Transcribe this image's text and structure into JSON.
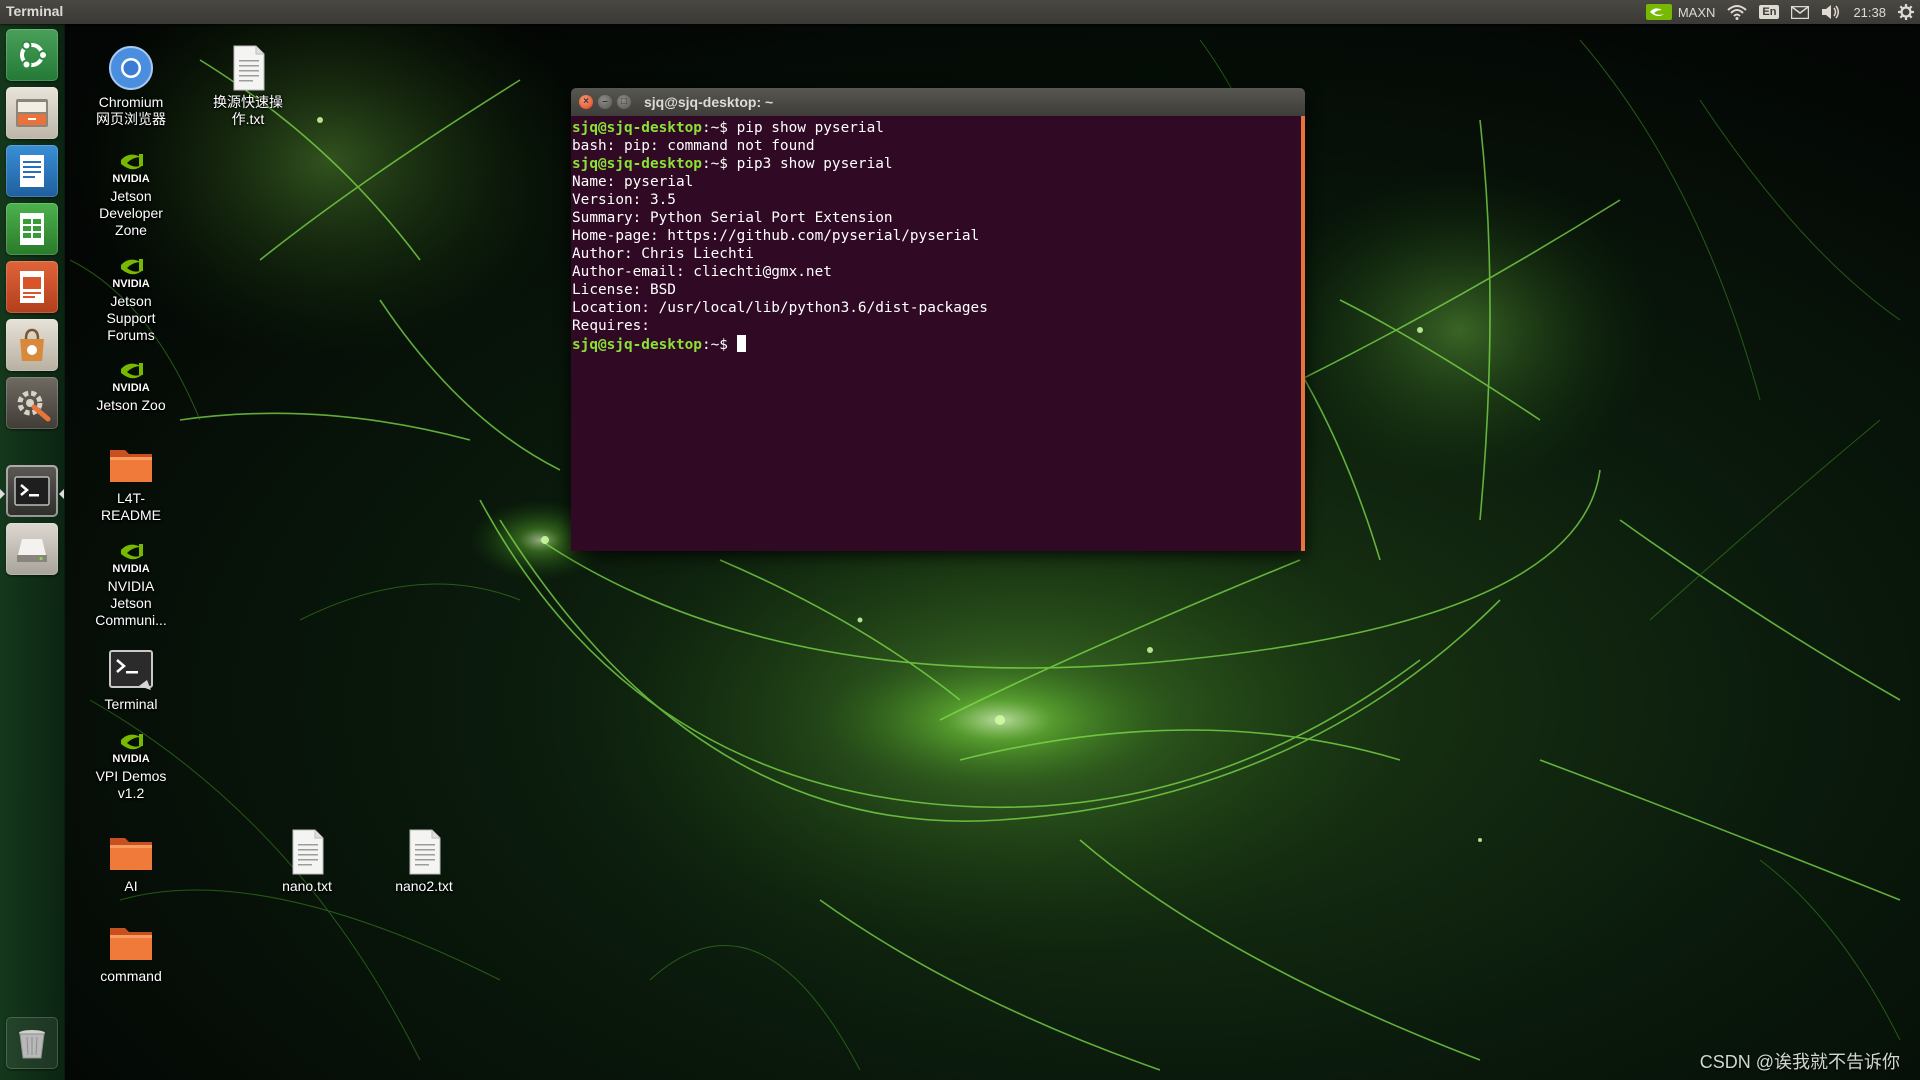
{
  "top_panel": {
    "app_title": "Terminal",
    "power_mode": "MAXN",
    "language": "En",
    "clock": "21:38"
  },
  "launcher": {
    "items": [
      {
        "name": "dash-home",
        "icon": "ubuntu-logo-icon"
      },
      {
        "name": "files",
        "icon": "file-manager-icon"
      },
      {
        "name": "libreoffice-writer",
        "icon": "writer-document-icon"
      },
      {
        "name": "libreoffice-calc",
        "icon": "spreadsheet-icon"
      },
      {
        "name": "libreoffice-impress",
        "icon": "presentation-icon"
      },
      {
        "name": "software-center",
        "icon": "shopping-bag-icon"
      },
      {
        "name": "system-settings",
        "icon": "settings-wrench-icon"
      },
      {
        "name": "terminal",
        "icon": "terminal-icon",
        "active": true
      },
      {
        "name": "disk",
        "icon": "drive-icon"
      },
      {
        "name": "trash",
        "icon": "trash-icon"
      }
    ]
  },
  "desktop": {
    "icons": [
      {
        "label": "Chromium\n网页浏览器",
        "icon": "chromium-icon"
      },
      {
        "label": "换源快速操\n作.txt",
        "icon": "text-file-icon"
      },
      {
        "label": "Jetson\nDeveloper\nZone",
        "icon": "nvidia-icon"
      },
      {
        "label": "Jetson\nSupport\nForums",
        "icon": "nvidia-icon"
      },
      {
        "label": "Jetson Zoo",
        "icon": "nvidia-icon"
      },
      {
        "label": "L4T-\nREADME",
        "icon": "folder-icon"
      },
      {
        "label": "NVIDIA\nJetson\nCommuni...",
        "icon": "nvidia-icon"
      },
      {
        "label": "Terminal",
        "icon": "terminal-icon"
      },
      {
        "label": "VPI Demos\nv1.2",
        "icon": "nvidia-icon"
      },
      {
        "label": "AI",
        "icon": "folder-icon"
      },
      {
        "label": "nano.txt",
        "icon": "text-file-icon"
      },
      {
        "label": "nano2.txt",
        "icon": "text-file-icon"
      },
      {
        "label": "command",
        "icon": "folder-icon"
      }
    ],
    "nvidia_badge": "NVIDIA"
  },
  "terminal": {
    "title": "sjq@sjq-desktop: ~",
    "prompt": "sjq@sjq-desktop",
    "prompt_suffix": ":~$ ",
    "lines": [
      {
        "cmd": "pip show pyserial"
      },
      {
        "out": "bash: pip: command not found"
      },
      {
        "cmd": "pip3 show pyserial"
      },
      {
        "out": "Name: pyserial"
      },
      {
        "out": "Version: 3.5"
      },
      {
        "out": "Summary: Python Serial Port Extension"
      },
      {
        "out": "Home-page: https://github.com/pyserial/pyserial"
      },
      {
        "out": "Author: Chris Liechti"
      },
      {
        "out": "Author-email: cliechti@gmx.net"
      },
      {
        "out": "License: BSD"
      },
      {
        "out": "Location: /usr/local/lib/python3.6/dist-packages"
      },
      {
        "out": "Requires:"
      }
    ]
  },
  "watermark": "CSDN @诶我就不告诉你",
  "colors": {
    "terminal_bg": "#300a24",
    "prompt_green": "#8ae234",
    "nvidia_green": "#76b900",
    "accent_orange": "#e8743b"
  }
}
